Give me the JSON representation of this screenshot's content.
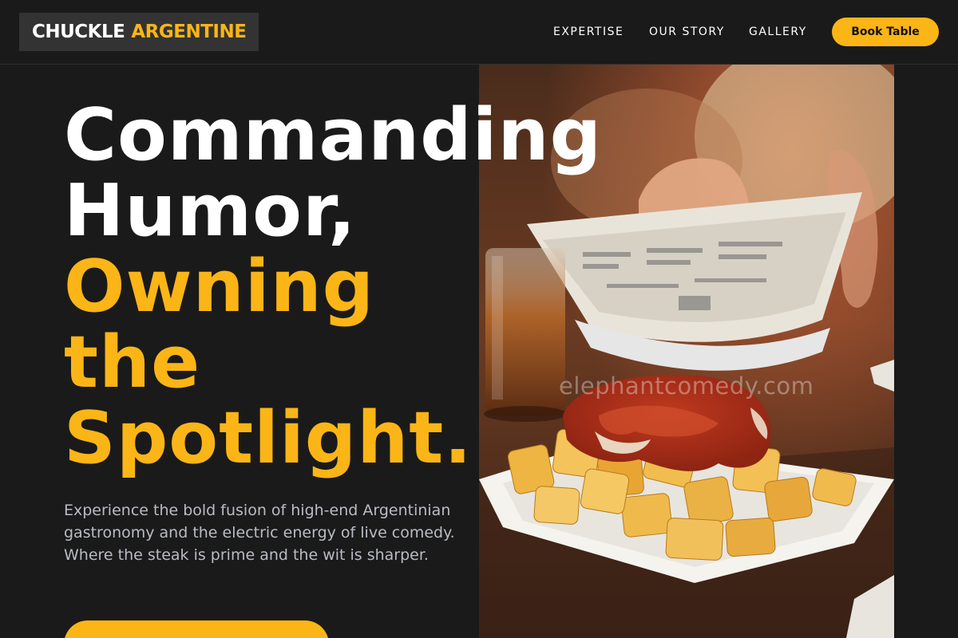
{
  "brand": {
    "name_part1": "CHUCKLE",
    "name_part2": "ARGENTINE"
  },
  "nav": {
    "links": [
      "EXPERTISE",
      "OUR STORY",
      "GALLERY"
    ],
    "book_label": "Book Table"
  },
  "hero": {
    "headline_white": [
      "Commanding",
      "Humor,"
    ],
    "headline_gold": [
      "Owning",
      "the",
      "Spotlight."
    ],
    "lead": "Experience the bold fusion of high-end Argentinian gastronomy and the electric energy of live comedy. Where the steak is prime and the wit is sharper.",
    "image_watermark": "elephantcomedy.com"
  },
  "colors": {
    "background": "#1a1a1a",
    "accent": "#fbb516",
    "text": "#ffffff",
    "muted": "#b9bcc3"
  }
}
